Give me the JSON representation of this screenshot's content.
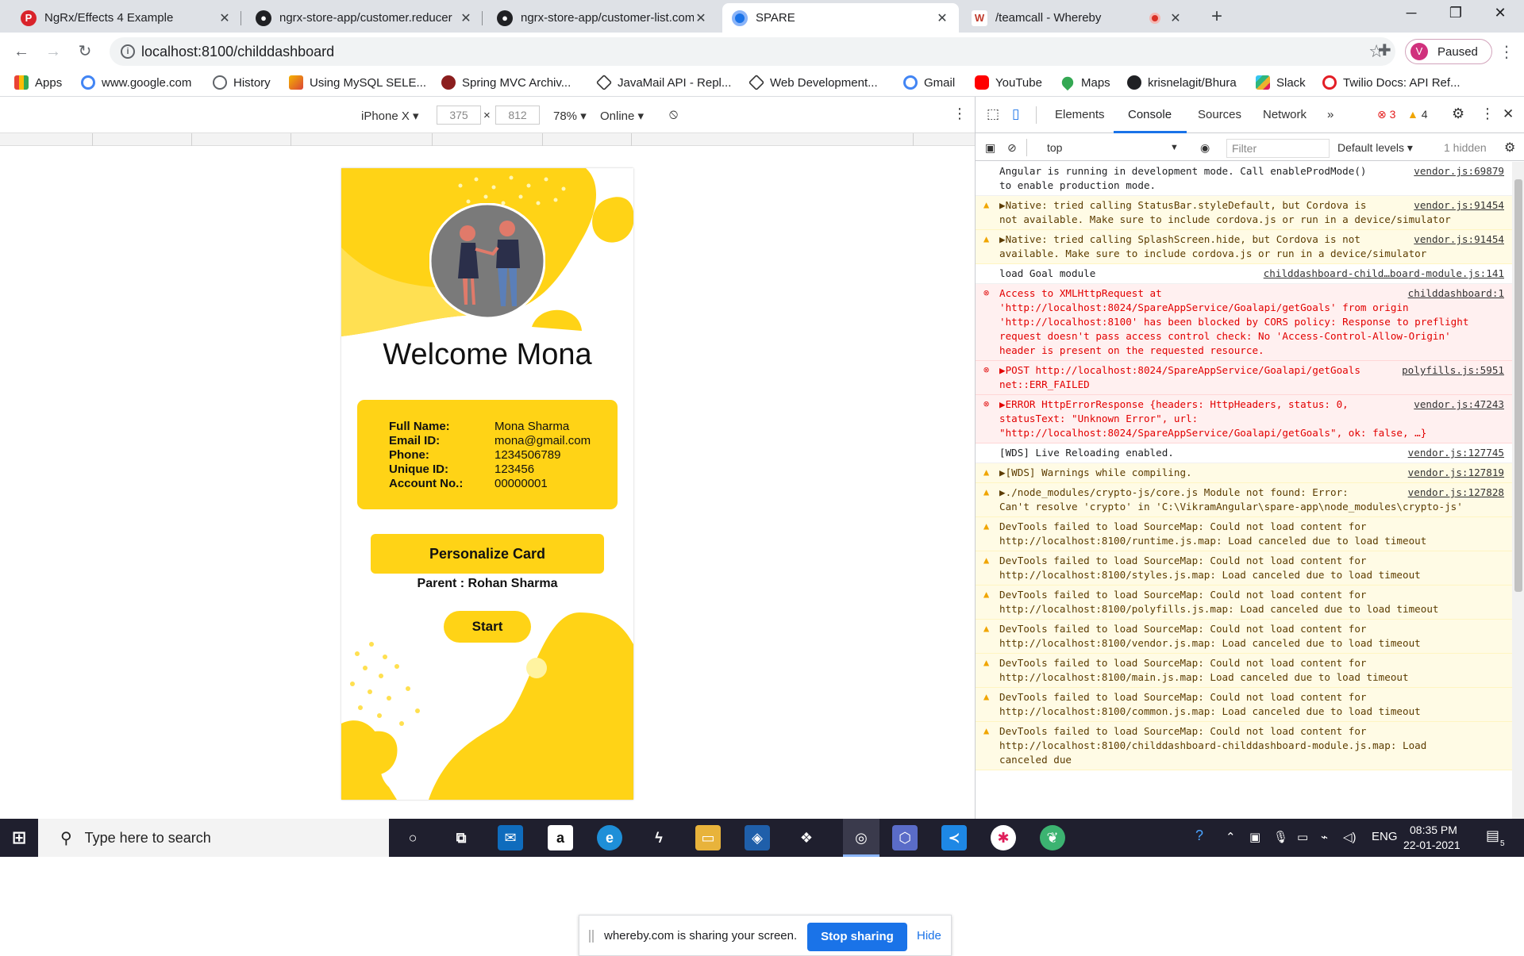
{
  "browser": {
    "tabs": [
      {
        "title": "NgRx/Effects 4 Example",
        "icon": "codepen-icon",
        "active": false
      },
      {
        "title": "ngrx-store-app/customer.reducer",
        "icon": "github-icon",
        "active": false
      },
      {
        "title": "ngrx-store-app/customer-list.com",
        "icon": "github-icon",
        "active": false
      },
      {
        "title": "SPARE",
        "icon": "chrome-icon",
        "active": true
      },
      {
        "title": "/teamcall - Whereby",
        "icon": "whereby-icon",
        "active": false
      }
    ],
    "url": "localhost:8100/childdashboard",
    "profile_initial": "V",
    "profile_status": "Paused",
    "bookmarks": [
      {
        "label": "Apps",
        "icon": "apps-grid-icon"
      },
      {
        "label": "www.google.com",
        "icon": "google-icon"
      },
      {
        "label": "History",
        "icon": "history-icon"
      },
      {
        "label": "Using MySQL SELE...",
        "icon": "mysql-icon"
      },
      {
        "label": "Spring MVC Archiv...",
        "icon": "spring-icon"
      },
      {
        "label": "JavaMail API - Repl...",
        "icon": "javamail-icon"
      },
      {
        "label": "Web Development...",
        "icon": "webdev-icon"
      },
      {
        "label": "Gmail",
        "icon": "google-icon"
      },
      {
        "label": "YouTube",
        "icon": "youtube-icon"
      },
      {
        "label": "Maps",
        "icon": "maps-icon"
      },
      {
        "label": "krisnelagit/Bhura",
        "icon": "github-icon"
      },
      {
        "label": "Slack",
        "icon": "slack-icon"
      },
      {
        "label": "Twilio Docs: API Ref...",
        "icon": "twilio-icon"
      }
    ]
  },
  "device_toolbar": {
    "device": "iPhone X",
    "width": "375",
    "times": "×",
    "height": "812",
    "zoom": "78%",
    "network": "Online"
  },
  "app": {
    "welcome": "Welcome Mona",
    "details": [
      {
        "label": "Full Name:",
        "value": "Mona Sharma"
      },
      {
        "label": "Email ID:",
        "value": "mona@gmail.com"
      },
      {
        "label": "Phone:",
        "value": "1234506789"
      },
      {
        "label": "Unique ID:",
        "value": "123456"
      },
      {
        "label": "Account No.:",
        "value": "00000001"
      }
    ],
    "personalize_label": "Personalize Card",
    "parent_label": "Parent : Rohan Sharma",
    "start_label": "Start",
    "accent": "#ffd316"
  },
  "share_notice": {
    "message": "whereby.com is sharing your screen.",
    "stop": "Stop sharing",
    "hide": "Hide"
  },
  "devtools": {
    "tabs": [
      "Elements",
      "Console",
      "Sources",
      "Network"
    ],
    "active_tab": "Console",
    "error_count": "3",
    "warning_count": "4",
    "context": "top",
    "filter_placeholder": "Filter",
    "levels": "Default levels",
    "hidden": "1 hidden",
    "messages": [
      {
        "level": "info",
        "text": "Angular is running in development mode. Call enableProdMode() to enable production mode.",
        "source": "vendor.js:69879"
      },
      {
        "level": "warn",
        "text": "▶Native: tried calling StatusBar.styleDefault, but Cordova is not available. Make sure to include cordova.js or run in a device/simulator",
        "source": "vendor.js:91454"
      },
      {
        "level": "warn",
        "text": "▶Native: tried calling SplashScreen.hide, but Cordova is not available. Make sure to include cordova.js or run in a device/simulator",
        "source": "vendor.js:91454"
      },
      {
        "level": "info",
        "text": "load Goal module",
        "source": "childdashboard-child…board-module.js:141"
      },
      {
        "level": "err",
        "text": "Access to XMLHttpRequest at 'http://localhost:8024/SpareAppService/Goalapi/getGoals' from origin 'http://localhost:8100' has been blocked by CORS policy: Response to preflight request doesn't pass access control check: No 'Access-Control-Allow-Origin' header is present on the requested resource.",
        "source": "childdashboard:1"
      },
      {
        "level": "err",
        "text": "▶POST http://localhost:8024/SpareAppService/Goalapi/getGoals net::ERR_FAILED",
        "source": "polyfills.js:5951"
      },
      {
        "level": "err",
        "text": "▶ERROR HttpErrorResponse {headers: HttpHeaders, status: 0, statusText: \"Unknown Error\", url: \"http://localhost:8024/SpareAppService/Goalapi/getGoals\", ok: false, …}",
        "source": "vendor.js:47243"
      },
      {
        "level": "info",
        "text": "[WDS] Live Reloading enabled.",
        "source": "vendor.js:127745"
      },
      {
        "level": "warn",
        "text": "▶[WDS] Warnings while compiling.",
        "source": "vendor.js:127819"
      },
      {
        "level": "warn",
        "text": "▶./node_modules/crypto-js/core.js Module not found: Error: Can't resolve 'crypto' in 'C:\\VikramAngular\\spare-app\\node_modules\\crypto-js'",
        "source": "vendor.js:127828"
      },
      {
        "level": "warn",
        "text": "DevTools failed to load SourceMap: Could not load content for http://localhost:8100/runtime.js.map: Load canceled due to load timeout",
        "source": ""
      },
      {
        "level": "warn",
        "text": "DevTools failed to load SourceMap: Could not load content for http://localhost:8100/styles.js.map: Load canceled due to load timeout",
        "source": ""
      },
      {
        "level": "warn",
        "text": "DevTools failed to load SourceMap: Could not load content for http://localhost:8100/polyfills.js.map: Load canceled due to load timeout",
        "source": ""
      },
      {
        "level": "warn",
        "text": "DevTools failed to load SourceMap: Could not load content for http://localhost:8100/vendor.js.map: Load canceled due to load timeout",
        "source": ""
      },
      {
        "level": "warn",
        "text": "DevTools failed to load SourceMap: Could not load content for http://localhost:8100/main.js.map: Load canceled due to load timeout",
        "source": ""
      },
      {
        "level": "warn",
        "text": "DevTools failed to load SourceMap: Could not load content for http://localhost:8100/common.js.map: Load canceled due to load timeout",
        "source": ""
      },
      {
        "level": "warn",
        "text": "DevTools failed to load SourceMap: Could not load content for http://localhost:8100/childdashboard-childdashboard-module.js.map: Load canceled due",
        "source": ""
      }
    ]
  },
  "taskbar": {
    "search_placeholder": "Type here to search",
    "language": "ENG",
    "time": "08:35 PM",
    "date": "22-01-2021",
    "notification_count": "5"
  }
}
